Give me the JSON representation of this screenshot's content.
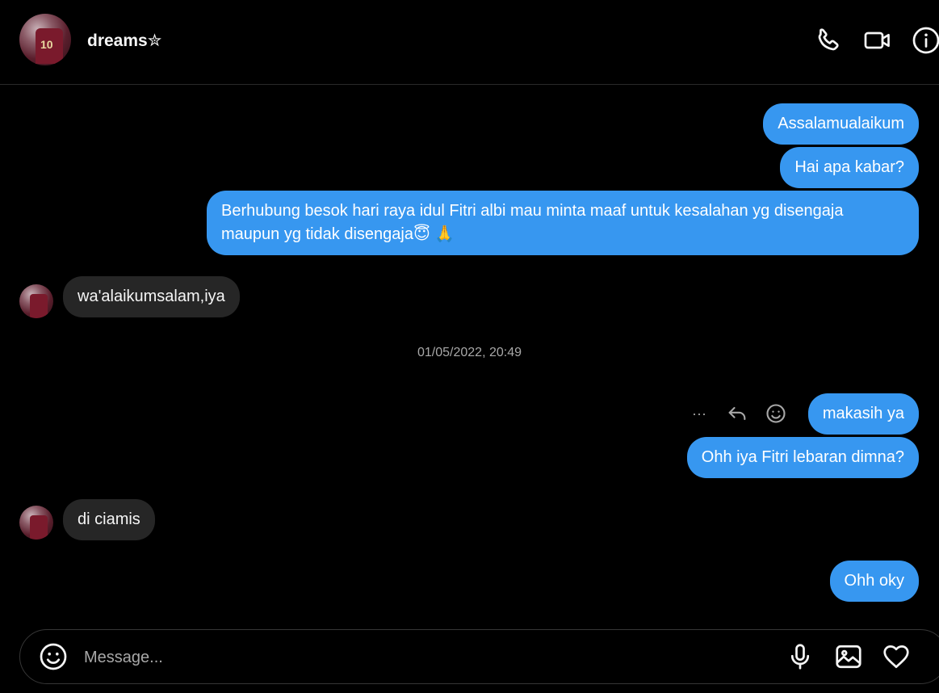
{
  "header": {
    "username": "dreams✮",
    "icons": [
      "phone-icon",
      "video-call-icon",
      "info-icon"
    ]
  },
  "messages": {
    "m1": "Assalamualaikum",
    "m2": "Hai apa kabar?",
    "m3": "Berhubung besok hari raya idul Fitri albi mau minta maaf untuk kesalahan yg disengaja maupun yg tidak disengaja😇 🙏",
    "m4": "wa'alaikumsalam,iya",
    "timestamp": "01/05/2022, 20:49",
    "m5": "makasih ya",
    "m6": "Ohh iya Fitri lebaran dimna?",
    "m7": "di ciamis",
    "m8": "Ohh oky"
  },
  "message_actions": {
    "more": "···"
  },
  "composer": {
    "placeholder": "Message...",
    "icons": [
      "emoji-icon",
      "microphone-icon",
      "image-icon",
      "heart-icon"
    ]
  },
  "colors": {
    "outgoing_bubble": "#3797f0",
    "incoming_bubble": "#262626",
    "background": "#000000"
  }
}
